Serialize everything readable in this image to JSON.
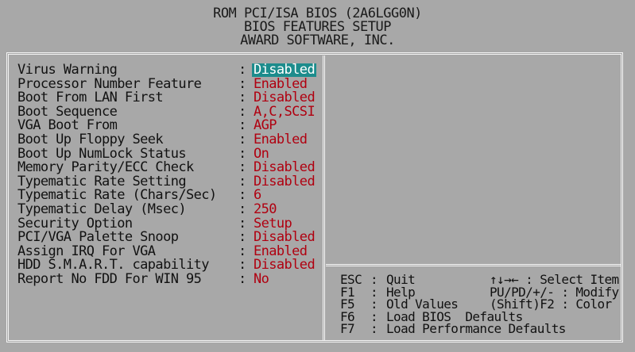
{
  "header": {
    "line1": "ROM PCI/ISA BIOS (2A6LGG0N)",
    "line2": "BIOS FEATURES SETUP",
    "line3": "AWARD SOFTWARE, INC."
  },
  "settings": [
    {
      "label": "Virus Warning",
      "value": "Disabled",
      "selected": true
    },
    {
      "label": "Processor Number Feature",
      "value": "Enabled"
    },
    {
      "label": "Boot From LAN First",
      "value": "Disabled"
    },
    {
      "label": "Boot Sequence",
      "value": "A,C,SCSI"
    },
    {
      "label": "VGA Boot From",
      "value": "AGP"
    },
    {
      "label": "Boot Up Floppy Seek",
      "value": "Enabled"
    },
    {
      "label": "Boot Up NumLock Status",
      "value": "On"
    },
    {
      "label": "Memory Parity/ECC Check",
      "value": "Disabled"
    },
    {
      "label": "Typematic Rate Setting",
      "value": "Disabled"
    },
    {
      "label": "Typematic Rate (Chars/Sec)",
      "value": "6"
    },
    {
      "label": "Typematic Delay (Msec)",
      "value": "250"
    },
    {
      "label": "Security Option",
      "value": "Setup"
    },
    {
      "label": "PCI/VGA Palette Snoop",
      "value": "Disabled"
    },
    {
      "label": "Assign IRQ For VGA",
      "value": "Enabled"
    },
    {
      "label": "HDD S.M.A.R.T. capability",
      "value": "Disabled"
    },
    {
      "label": "Report No FDD For WIN 95",
      "value": "No"
    }
  ],
  "separator": ":",
  "keys": [
    {
      "key": "ESC",
      "action": "Quit",
      "right": "↑↓→← : Select Item"
    },
    {
      "key": "F1",
      "action": "Help",
      "right": "PU/PD/+/- : Modify"
    },
    {
      "key": "F5",
      "action": "Old Values",
      "right": "(Shift)F2 : Color"
    },
    {
      "key": "F6",
      "action": "Load BIOS  Defaults",
      "right": ""
    },
    {
      "key": "F7",
      "action": "Load Performance Defaults",
      "right": ""
    }
  ],
  "colors": {
    "background": "#a8a8a8",
    "value_text": "#b00010",
    "highlight": "#1c8c8c",
    "border": "#f4f4f4"
  }
}
